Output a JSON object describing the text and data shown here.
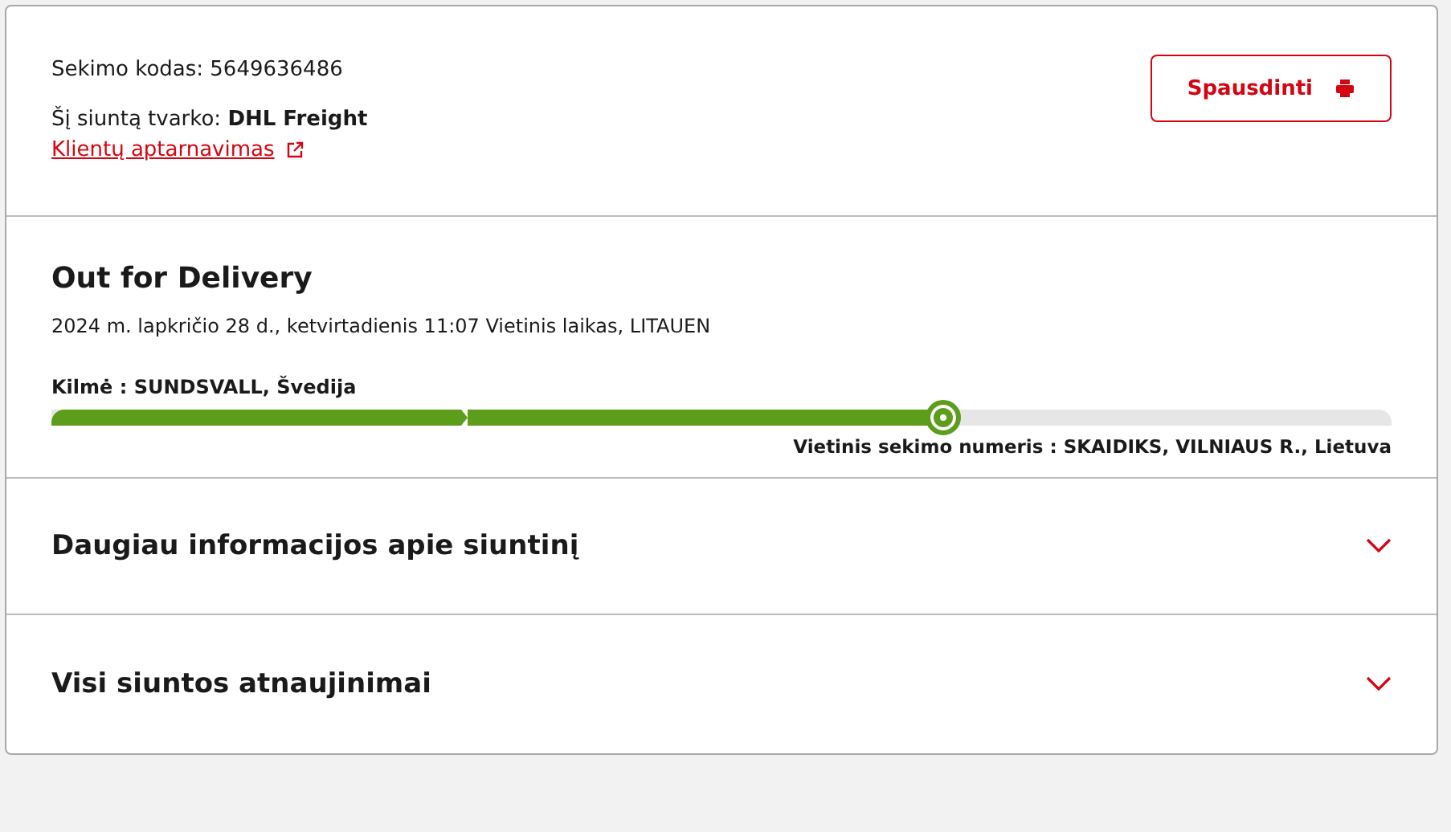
{
  "header": {
    "tracking_code": "Sekimo kodas: 5649636486",
    "handled_by": "Šį siuntą tvarko: **DHL Freight**",
    "customer_service_link": "Klientų aptarnavimas",
    "print_button": "Spausdinti"
  },
  "status": {
    "title": "Out for Delivery",
    "timestamp": "2024 m. lapkričio 28 d., ketvirtadienis 11:07 Vietinis laikas, LITAUEN",
    "origin": "Kilmė : SUNDSVALL, Švedija",
    "destination": "Vietinis sekimo numeris : SKAIDIKS, VILNIAUS R., Lietuva"
  },
  "sections": [
    {
      "title": "Daugiau informacijos apie siuntinį",
      "expanded": false
    },
    {
      "title": "Visi siuntos atnaujinimai",
      "expanded": false
    }
  ]
}
